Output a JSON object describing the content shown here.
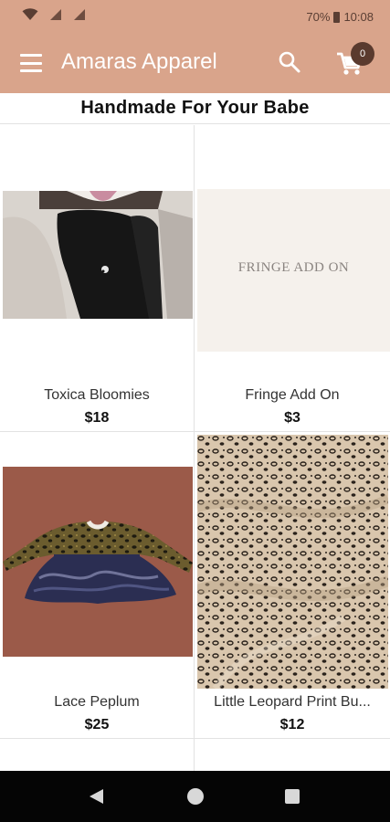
{
  "status_bar": {
    "battery": "70%",
    "time": "10:08"
  },
  "app": {
    "title": "Amaras Apparel",
    "cart_count": "0"
  },
  "page": {
    "heading": "Handmade For Your Babe"
  },
  "products": [
    {
      "name": "Toxica Bloomies",
      "price": "$18"
    },
    {
      "name": "Fringe Add On",
      "price": "$3",
      "image_text": "FRINGE ADD ON"
    },
    {
      "name": "Lace Peplum",
      "price": "$25"
    },
    {
      "name": "Little Leopard Print Bu...",
      "price": "$12"
    }
  ],
  "colors": {
    "app_bar": "#d9a48b",
    "badge": "#5a3a2e",
    "nav_bar": "#050505"
  },
  "icons": [
    "wifi-icon",
    "signal-icon",
    "battery-icon",
    "menu-icon",
    "search-icon",
    "cart-icon",
    "back-icon",
    "home-icon",
    "recents-icon"
  ]
}
